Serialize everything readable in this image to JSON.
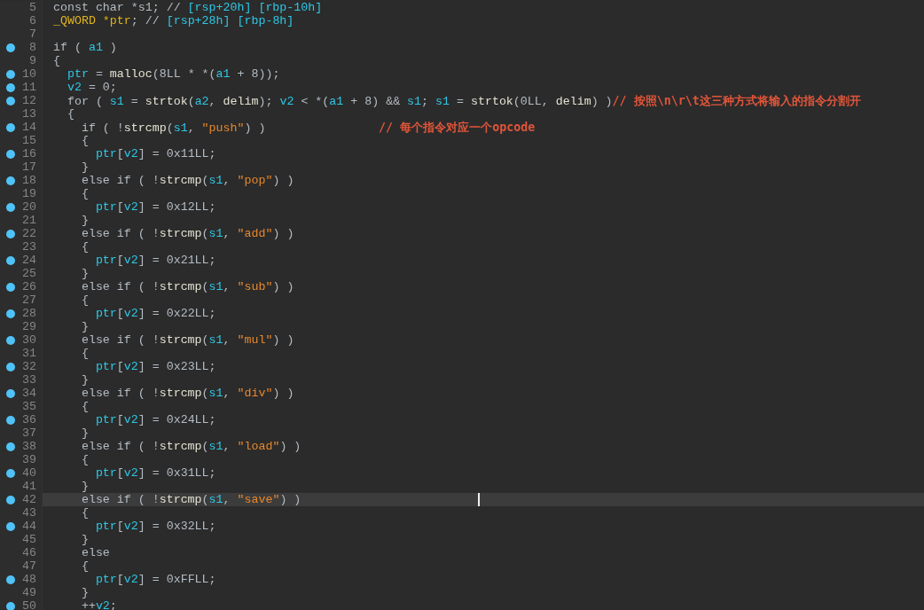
{
  "lines": [
    {
      "number": "5",
      "marked": false,
      "segments": [
        {
          "kind": "plain",
          "text": "const char *s1; // "
        },
        {
          "kind": "var",
          "text": "[rsp+20h] [rbp-10h]"
        }
      ]
    },
    {
      "number": "6",
      "marked": false,
      "segments": [
        {
          "kind": "type",
          "text": "_QWORD *ptr"
        },
        {
          "kind": "plain",
          "text": "; // "
        },
        {
          "kind": "var",
          "text": "[rsp+28h] [rbp-8h]"
        }
      ]
    },
    {
      "number": "7",
      "marked": false
    },
    {
      "number": "8",
      "marked": true,
      "segments": [
        {
          "kind": "plain",
          "text": "if ( "
        },
        {
          "kind": "var",
          "text": "a1"
        },
        {
          "kind": "plain",
          "text": " )"
        }
      ]
    },
    {
      "number": "9",
      "marked": false,
      "segments": [
        {
          "kind": "plain",
          "text": "{"
        }
      ]
    },
    {
      "number": "10",
      "marked": true,
      "segments": [
        {
          "kind": "var",
          "text": "  ptr"
        },
        {
          "kind": "plain",
          "text": " = "
        },
        {
          "kind": "name",
          "text": "malloc"
        },
        {
          "kind": "plain",
          "text": "(8LL * *("
        },
        {
          "kind": "var",
          "text": "a1"
        },
        {
          "kind": "plain",
          "text": " + 8));"
        }
      ]
    },
    {
      "number": "11",
      "marked": true,
      "segments": [
        {
          "kind": "var",
          "text": "  v2"
        },
        {
          "kind": "plain",
          "text": " = 0;"
        }
      ]
    },
    {
      "number": "12",
      "marked": true,
      "segments": [
        {
          "kind": "plain",
          "text": "  for ( "
        },
        {
          "kind": "var",
          "text": "s1"
        },
        {
          "kind": "plain",
          "text": " = "
        },
        {
          "kind": "name",
          "text": "strtok"
        },
        {
          "kind": "plain",
          "text": "("
        },
        {
          "kind": "var",
          "text": "a2"
        },
        {
          "kind": "plain",
          "text": ", "
        },
        {
          "kind": "name",
          "text": "delim"
        },
        {
          "kind": "plain",
          "text": "); "
        },
        {
          "kind": "var",
          "text": "v2"
        },
        {
          "kind": "plain",
          "text": " < *("
        },
        {
          "kind": "var",
          "text": "a1"
        },
        {
          "kind": "plain",
          "text": " + 8) && "
        },
        {
          "kind": "var",
          "text": "s1"
        },
        {
          "kind": "plain",
          "text": "; "
        },
        {
          "kind": "var",
          "text": "s1"
        },
        {
          "kind": "plain",
          "text": " = "
        },
        {
          "kind": "name",
          "text": "strtok"
        },
        {
          "kind": "plain",
          "text": "(0LL, "
        },
        {
          "kind": "name",
          "text": "delim"
        },
        {
          "kind": "plain",
          "text": ") )"
        },
        {
          "kind": "comment",
          "text": "// 按照\\n\\r\\t这三种方式将输入的指令分割开"
        }
      ]
    },
    {
      "number": "13",
      "marked": false,
      "segments": [
        {
          "kind": "plain",
          "text": "  {"
        }
      ]
    },
    {
      "number": "14",
      "marked": true,
      "segments": [
        {
          "kind": "plain",
          "text": "    if ( !"
        },
        {
          "kind": "name",
          "text": "strcmp"
        },
        {
          "kind": "plain",
          "text": "("
        },
        {
          "kind": "var",
          "text": "s1"
        },
        {
          "kind": "plain",
          "text": ", "
        },
        {
          "kind": "string",
          "text": "\"push\""
        },
        {
          "kind": "plain",
          "text": ") )                "
        },
        {
          "kind": "comment",
          "text": "// 每个指令对应一个opcode"
        }
      ]
    },
    {
      "number": "15",
      "marked": false,
      "segments": [
        {
          "kind": "plain",
          "text": "    {"
        }
      ]
    },
    {
      "number": "16",
      "marked": true,
      "segments": [
        {
          "kind": "var",
          "text": "      ptr"
        },
        {
          "kind": "plain",
          "text": "["
        },
        {
          "kind": "var",
          "text": "v2"
        },
        {
          "kind": "plain",
          "text": "] = 0x11LL;"
        }
      ]
    },
    {
      "number": "17",
      "marked": false,
      "segments": [
        {
          "kind": "plain",
          "text": "    }"
        }
      ]
    },
    {
      "number": "18",
      "marked": true,
      "segments": [
        {
          "kind": "plain",
          "text": "    else if ( !"
        },
        {
          "kind": "name",
          "text": "strcmp"
        },
        {
          "kind": "plain",
          "text": "("
        },
        {
          "kind": "var",
          "text": "s1"
        },
        {
          "kind": "plain",
          "text": ", "
        },
        {
          "kind": "string",
          "text": "\"pop\""
        },
        {
          "kind": "plain",
          "text": ") )"
        }
      ]
    },
    {
      "number": "19",
      "marked": false,
      "segments": [
        {
          "kind": "plain",
          "text": "    {"
        }
      ]
    },
    {
      "number": "20",
      "marked": true,
      "segments": [
        {
          "kind": "var",
          "text": "      ptr"
        },
        {
          "kind": "plain",
          "text": "["
        },
        {
          "kind": "var",
          "text": "v2"
        },
        {
          "kind": "plain",
          "text": "] = 0x12LL;"
        }
      ]
    },
    {
      "number": "21",
      "marked": false,
      "segments": [
        {
          "kind": "plain",
          "text": "    }"
        }
      ]
    },
    {
      "number": "22",
      "marked": true,
      "segments": [
        {
          "kind": "plain",
          "text": "    else if ( !"
        },
        {
          "kind": "name",
          "text": "strcmp"
        },
        {
          "kind": "plain",
          "text": "("
        },
        {
          "kind": "var",
          "text": "s1"
        },
        {
          "kind": "plain",
          "text": ", "
        },
        {
          "kind": "string",
          "text": "\"add\""
        },
        {
          "kind": "plain",
          "text": ") )"
        }
      ]
    },
    {
      "number": "23",
      "marked": false,
      "segments": [
        {
          "kind": "plain",
          "text": "    {"
        }
      ]
    },
    {
      "number": "24",
      "marked": true,
      "segments": [
        {
          "kind": "var",
          "text": "      ptr"
        },
        {
          "kind": "plain",
          "text": "["
        },
        {
          "kind": "var",
          "text": "v2"
        },
        {
          "kind": "plain",
          "text": "] = 0x21LL;"
        }
      ]
    },
    {
      "number": "25",
      "marked": false,
      "segments": [
        {
          "kind": "plain",
          "text": "    }"
        }
      ]
    },
    {
      "number": "26",
      "marked": true,
      "segments": [
        {
          "kind": "plain",
          "text": "    else if ( !"
        },
        {
          "kind": "name",
          "text": "strcmp"
        },
        {
          "kind": "plain",
          "text": "("
        },
        {
          "kind": "var",
          "text": "s1"
        },
        {
          "kind": "plain",
          "text": ", "
        },
        {
          "kind": "string",
          "text": "\"sub\""
        },
        {
          "kind": "plain",
          "text": ") )"
        }
      ]
    },
    {
      "number": "27",
      "marked": false,
      "segments": [
        {
          "kind": "plain",
          "text": "    {"
        }
      ]
    },
    {
      "number": "28",
      "marked": true,
      "segments": [
        {
          "kind": "var",
          "text": "      ptr"
        },
        {
          "kind": "plain",
          "text": "["
        },
        {
          "kind": "var",
          "text": "v2"
        },
        {
          "kind": "plain",
          "text": "] = 0x22LL;"
        }
      ]
    },
    {
      "number": "29",
      "marked": false,
      "segments": [
        {
          "kind": "plain",
          "text": "    }"
        }
      ]
    },
    {
      "number": "30",
      "marked": true,
      "segments": [
        {
          "kind": "plain",
          "text": "    else if ( !"
        },
        {
          "kind": "name",
          "text": "strcmp"
        },
        {
          "kind": "plain",
          "text": "("
        },
        {
          "kind": "var",
          "text": "s1"
        },
        {
          "kind": "plain",
          "text": ", "
        },
        {
          "kind": "string",
          "text": "\"mul\""
        },
        {
          "kind": "plain",
          "text": ") )"
        }
      ]
    },
    {
      "number": "31",
      "marked": false,
      "segments": [
        {
          "kind": "plain",
          "text": "    {"
        }
      ]
    },
    {
      "number": "32",
      "marked": true,
      "segments": [
        {
          "kind": "var",
          "text": "      ptr"
        },
        {
          "kind": "plain",
          "text": "["
        },
        {
          "kind": "var",
          "text": "v2"
        },
        {
          "kind": "plain",
          "text": "] = 0x23LL;"
        }
      ]
    },
    {
      "number": "33",
      "marked": false,
      "segments": [
        {
          "kind": "plain",
          "text": "    }"
        }
      ]
    },
    {
      "number": "34",
      "marked": true,
      "segments": [
        {
          "kind": "plain",
          "text": "    else if ( !"
        },
        {
          "kind": "name",
          "text": "strcmp"
        },
        {
          "kind": "plain",
          "text": "("
        },
        {
          "kind": "var",
          "text": "s1"
        },
        {
          "kind": "plain",
          "text": ", "
        },
        {
          "kind": "string",
          "text": "\"div\""
        },
        {
          "kind": "plain",
          "text": ") )"
        }
      ]
    },
    {
      "number": "35",
      "marked": false,
      "segments": [
        {
          "kind": "plain",
          "text": "    {"
        }
      ]
    },
    {
      "number": "36",
      "marked": true,
      "segments": [
        {
          "kind": "var",
          "text": "      ptr"
        },
        {
          "kind": "plain",
          "text": "["
        },
        {
          "kind": "var",
          "text": "v2"
        },
        {
          "kind": "plain",
          "text": "] = 0x24LL;"
        }
      ]
    },
    {
      "number": "37",
      "marked": false,
      "segments": [
        {
          "kind": "plain",
          "text": "    }"
        }
      ]
    },
    {
      "number": "38",
      "marked": true,
      "segments": [
        {
          "kind": "plain",
          "text": "    else if ( !"
        },
        {
          "kind": "name",
          "text": "strcmp"
        },
        {
          "kind": "plain",
          "text": "("
        },
        {
          "kind": "var",
          "text": "s1"
        },
        {
          "kind": "plain",
          "text": ", "
        },
        {
          "kind": "string",
          "text": "\"load\""
        },
        {
          "kind": "plain",
          "text": ") )"
        }
      ]
    },
    {
      "number": "39",
      "marked": false,
      "segments": [
        {
          "kind": "plain",
          "text": "    {"
        }
      ]
    },
    {
      "number": "40",
      "marked": true,
      "segments": [
        {
          "kind": "var",
          "text": "      ptr"
        },
        {
          "kind": "plain",
          "text": "["
        },
        {
          "kind": "var",
          "text": "v2"
        },
        {
          "kind": "plain",
          "text": "] = 0x31LL;"
        }
      ]
    },
    {
      "number": "41",
      "marked": false,
      "segments": [
        {
          "kind": "plain",
          "text": "    }"
        }
      ]
    },
    {
      "number": "42",
      "marked": true,
      "current": true,
      "cursor": true,
      "segments": [
        {
          "kind": "plain",
          "text": "    else if ( !"
        },
        {
          "kind": "name",
          "text": "strcmp"
        },
        {
          "kind": "plain",
          "text": "("
        },
        {
          "kind": "var",
          "text": "s1"
        },
        {
          "kind": "plain",
          "text": ", "
        },
        {
          "kind": "string",
          "text": "\"save\""
        },
        {
          "kind": "plain",
          "text": ") )"
        }
      ]
    },
    {
      "number": "43",
      "marked": false,
      "segments": [
        {
          "kind": "plain",
          "text": "    {"
        }
      ]
    },
    {
      "number": "44",
      "marked": true,
      "segments": [
        {
          "kind": "var",
          "text": "      ptr"
        },
        {
          "kind": "plain",
          "text": "["
        },
        {
          "kind": "var",
          "text": "v2"
        },
        {
          "kind": "plain",
          "text": "] = 0x32LL;"
        }
      ]
    },
    {
      "number": "45",
      "marked": false,
      "segments": [
        {
          "kind": "plain",
          "text": "    }"
        }
      ]
    },
    {
      "number": "46",
      "marked": false,
      "segments": [
        {
          "kind": "plain",
          "text": "    else"
        }
      ]
    },
    {
      "number": "47",
      "marked": false,
      "segments": [
        {
          "kind": "plain",
          "text": "    {"
        }
      ]
    },
    {
      "number": "48",
      "marked": true,
      "segments": [
        {
          "kind": "var",
          "text": "      ptr"
        },
        {
          "kind": "plain",
          "text": "["
        },
        {
          "kind": "var",
          "text": "v2"
        },
        {
          "kind": "plain",
          "text": "] = 0xFFLL;"
        }
      ]
    },
    {
      "number": "49",
      "marked": false,
      "segments": [
        {
          "kind": "plain",
          "text": "    }"
        }
      ]
    },
    {
      "number": "50",
      "marked": true,
      "segments": [
        {
          "kind": "plain",
          "text": "    ++"
        },
        {
          "kind": "var",
          "text": "v2"
        },
        {
          "kind": "plain",
          "text": ";"
        }
      ]
    }
  ]
}
